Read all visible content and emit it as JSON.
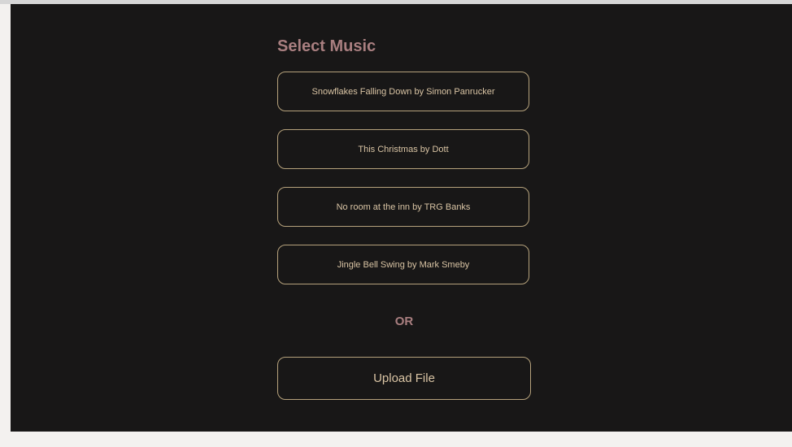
{
  "title": "Select Music",
  "tracks": [
    {
      "label": "Snowflakes Falling Down by Simon Panrucker"
    },
    {
      "label": "This Christmas by Dott"
    },
    {
      "label": "No room at the inn by TRG Banks"
    },
    {
      "label": "Jingle Bell Swing by Mark Smeby"
    }
  ],
  "divider_text": "OR",
  "upload_label": "Upload File",
  "colors": {
    "background": "#181717",
    "heading": "#a97f80",
    "button_border": "#b6a27c",
    "button_text": "#d9c4a4"
  }
}
